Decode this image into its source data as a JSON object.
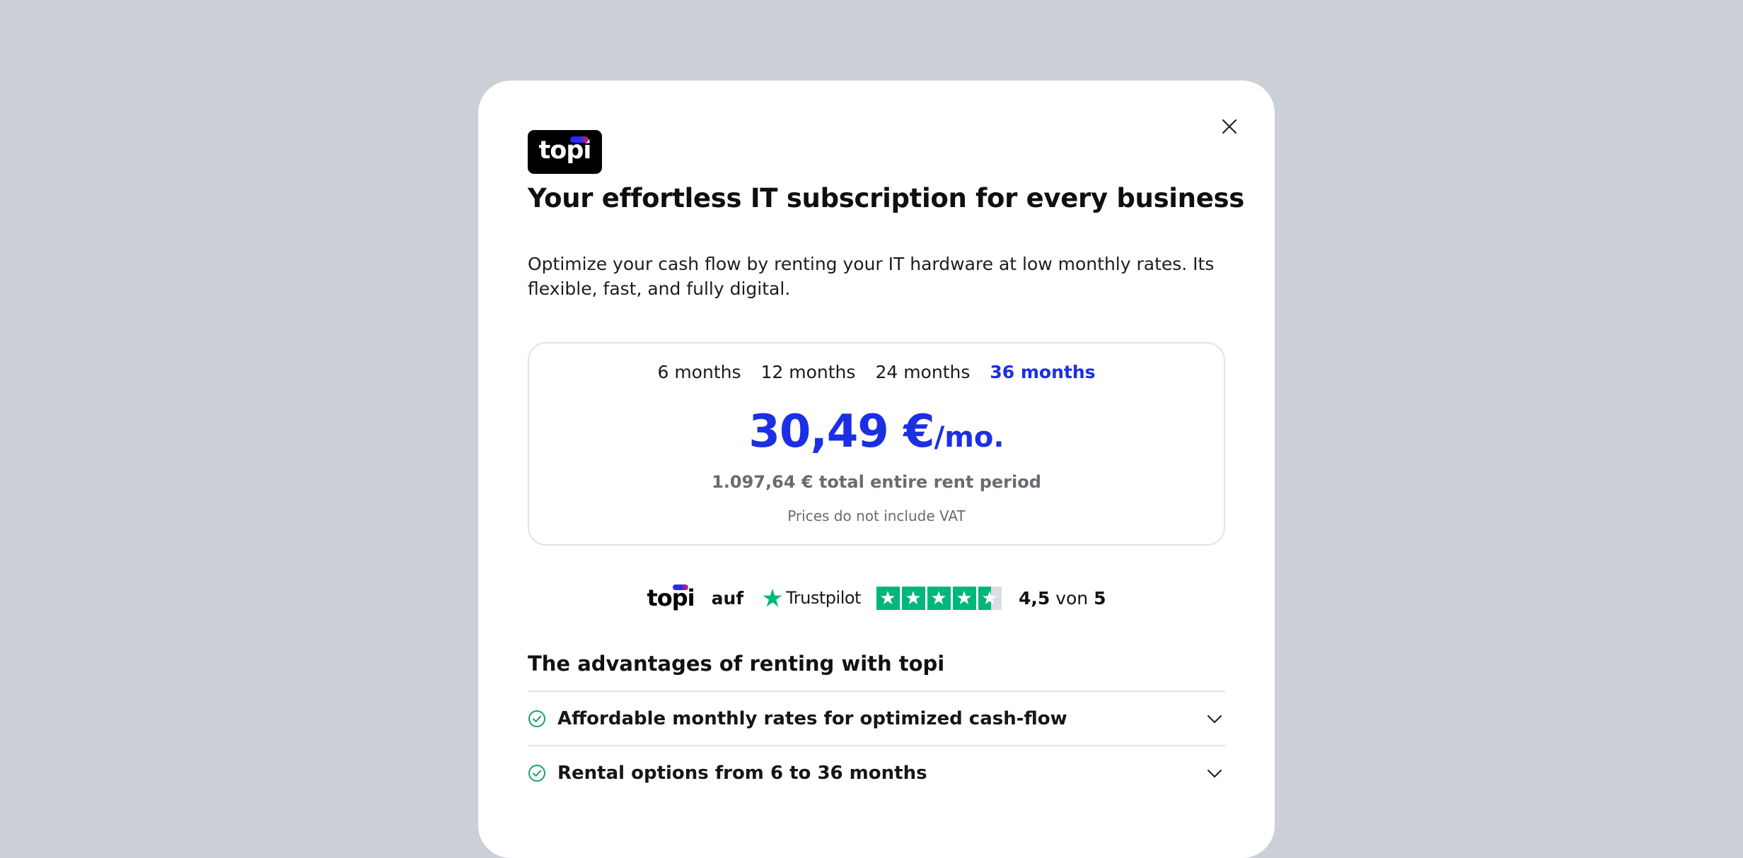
{
  "modal": {
    "close_icon": "close-icon",
    "logo_text": "topi",
    "title": "Your effortless IT subscription for every business",
    "description": "Optimize your cash flow by renting your IT hardware at low monthly rates. Its flexible, fast, and fully digital."
  },
  "pricing": {
    "tabs": [
      {
        "label": "6 months",
        "active": false
      },
      {
        "label": "12 months",
        "active": false
      },
      {
        "label": "24 months",
        "active": false
      },
      {
        "label": "36 months",
        "active": true
      }
    ],
    "price": "30,49 €",
    "price_unit": "/mo.",
    "total": "1.097,64 € total entire rent period",
    "vat_note": "Prices do not include VAT",
    "accent_color": "#1b2fe3"
  },
  "trustpilot": {
    "brand": "topi",
    "connector": "auf",
    "platform": "Trustpilot",
    "stars": 4.5,
    "score": "4,5",
    "von": "von",
    "max": "5",
    "star_color": "#00b67a"
  },
  "advantages": {
    "title": "The advantages of renting with topi",
    "items": [
      {
        "label": "Affordable monthly rates for optimized cash-flow",
        "icon": "check-circle-icon"
      },
      {
        "label": "Rental options from 6 to 36 months",
        "icon": "check-circle-icon"
      }
    ],
    "check_color": "#18a36b"
  }
}
